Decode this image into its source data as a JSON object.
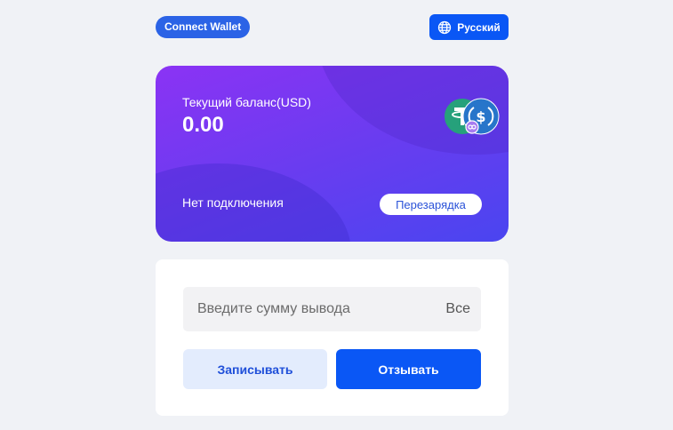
{
  "header": {
    "connect_label": "Connect Wallet",
    "language_label": "Русский",
    "language_icon": "globe-icon"
  },
  "balance": {
    "label": "Текущий баланс(USD)",
    "value": "0.00",
    "status": "Нет подключения",
    "recharge_label": "Перезарядка",
    "coin_icons": [
      "tether-icon",
      "usdc-icon"
    ],
    "colors": {
      "gradient_start": "#8b33f4",
      "gradient_end": "#4a45f0"
    }
  },
  "withdraw": {
    "amount_placeholder": "Введите сумму вывода",
    "all_label": "Все",
    "record_label": "Записывать",
    "withdraw_label": "Отзывать"
  },
  "colors": {
    "accent": "#0a57f5",
    "background": "#f0f2f6"
  }
}
